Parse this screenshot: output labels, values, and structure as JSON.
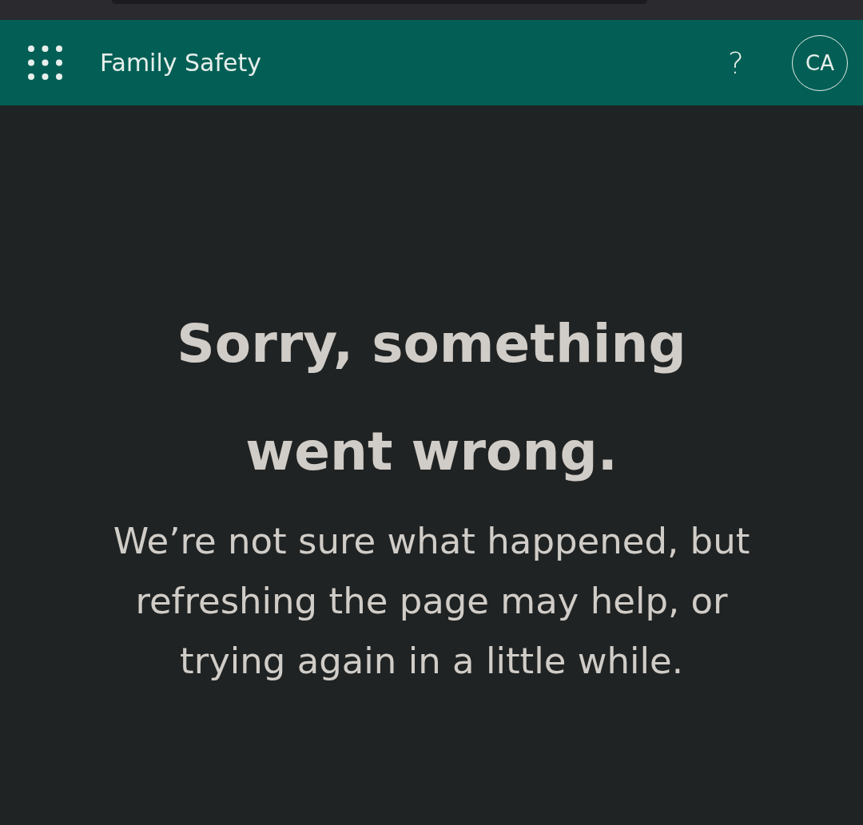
{
  "header": {
    "app_name": "Family Safety",
    "help": "?",
    "avatar_initials": "CA"
  },
  "error": {
    "title": "Sorry, something went wrong.",
    "message": "We’re not sure what happened, but refreshing the page may help, or trying again in a little while."
  }
}
